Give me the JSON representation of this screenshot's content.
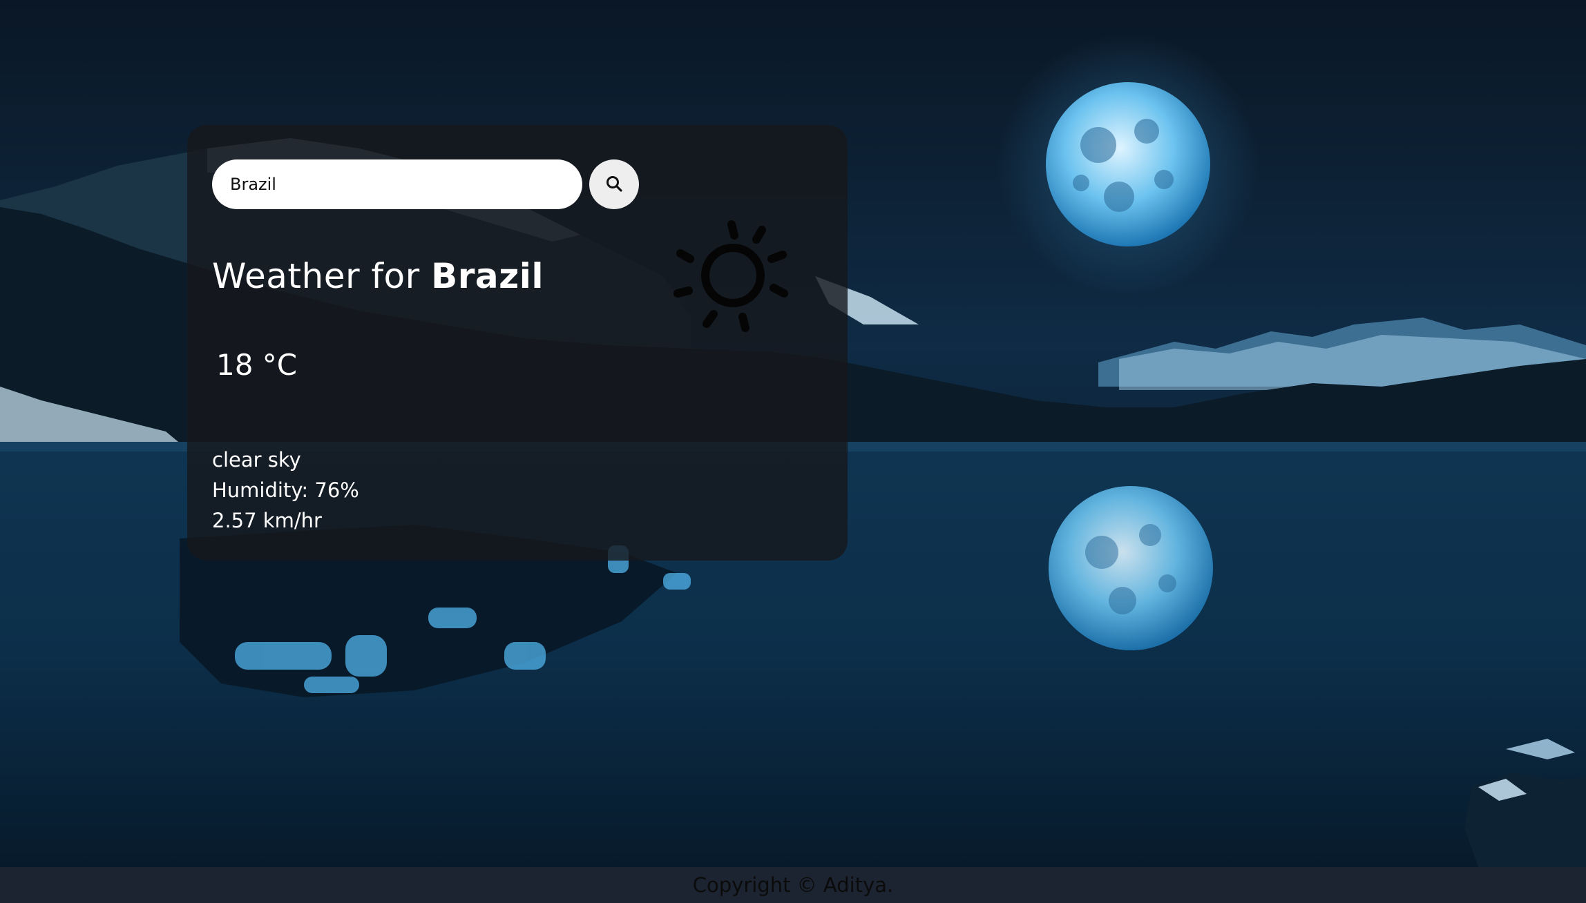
{
  "search": {
    "value": "Brazil",
    "icon": "search-icon"
  },
  "weather": {
    "title_prefix": "Weather for",
    "city": "Brazil",
    "temperature": "18 °C",
    "description": "clear sky",
    "humidity": "Humidity: 76%",
    "wind": "2.57 km/hr",
    "icon": "sun-icon"
  },
  "footer": {
    "copyright": "Copyright © Aditya."
  },
  "colors": {
    "card_background": "#16181c",
    "text": "#ffffff",
    "footer_background": "#1c2431"
  }
}
